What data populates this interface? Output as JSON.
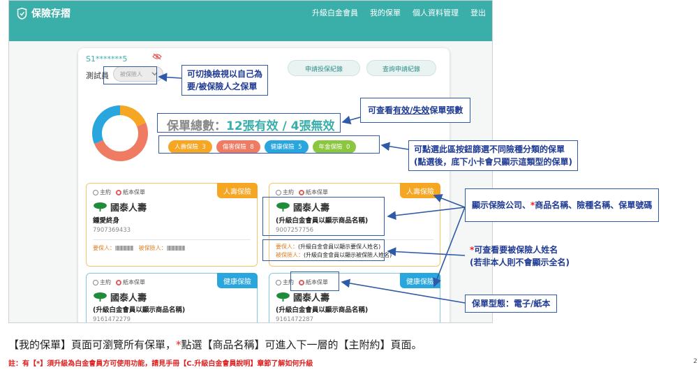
{
  "app": {
    "brand": "保險存摺"
  },
  "nav": [
    {
      "label": "升級白金會員"
    },
    {
      "label": "我的保單"
    },
    {
      "label": "個人資料管理"
    },
    {
      "label": "登出"
    }
  ],
  "account": {
    "masked_id": "S1*******5",
    "name": "測試員",
    "role_select": "被保險人"
  },
  "buttons": {
    "apply_record": "申請投保紀錄",
    "query_record": "查詢申請紀錄"
  },
  "summary": {
    "total_prefix": "保單總數：",
    "active": "12張有效",
    "separator": " / ",
    "inactive": "4張無效",
    "active_count": 12,
    "inactive_count": 4
  },
  "categories": [
    {
      "label": "人壽保險",
      "count": "3",
      "color": "#f5a623"
    },
    {
      "label": "傷害保險",
      "count": "8",
      "color": "#ef7b63"
    },
    {
      "label": "健康保險",
      "count": "5",
      "color": "#29a6de"
    },
    {
      "label": "年金保險",
      "count": "0",
      "color": "#8cc63e"
    }
  ],
  "policy_cards": [
    {
      "type": "人壽保險",
      "main_label": "主約",
      "paper_label": "紙本保單",
      "company": "國泰人壽",
      "product": "鍾愛終身",
      "number": "7907369433",
      "insured_owner_label": "要保人：",
      "insured_person_label": "被保險人：",
      "accent": "#f5a623"
    },
    {
      "type": "人壽保險",
      "main_label": "主約",
      "paper_label": "紙本保單",
      "company": "國泰人壽",
      "product": "(升級白金會員以顯示商品名稱)",
      "number": "9007257756",
      "insured_owner_label": "要保人：",
      "insured_owner_value": "(升級白金會員以顯示要保人姓名)",
      "insured_person_label": "被保險人：",
      "insured_person_value": "(升級白金會員以顯示被保險人姓名)",
      "accent": "#f5a623"
    },
    {
      "type": "健康保險",
      "main_label": "主約",
      "paper_label": "紙本保單",
      "company": "國泰人壽",
      "product": "(升級白金會員以顯示商品名稱)",
      "number": "9161472279",
      "accent": "#29a6de"
    },
    {
      "type": "健康保險",
      "main_label": "主約",
      "paper_label": "紙本保單",
      "company": "國泰人壽",
      "product": "(升級白金會員以顯示商品名稱)",
      "number": "9161472287",
      "accent": "#29a6de"
    }
  ],
  "annotations": {
    "switch_view_1": "可切換檢視以自己為",
    "switch_view_2": "要/被保險人之保單",
    "view_count_pre": "可查看",
    "view_count_u": "有效/失效",
    "view_count_post": "保單張數",
    "filter_1": "可點選此區按鈕篩選不同險種分類的保單",
    "filter_2": "(點選後，底下小卡會只顯示這類型的保單)",
    "display_pre": "顯示保險公司、",
    "display_star": "*",
    "display_post": "商品名稱、險種名稱、保單號碼",
    "name_star": "*",
    "name_1": "可查看要被保險人姓名",
    "name_2": "(若非本人則不會顯示全名)",
    "form_type": "保單型態：電子/紙本"
  },
  "footer": {
    "main_pre": "【我的保單】頁面可瀏覽所有保單，",
    "main_star": "*",
    "main_post": "點選【商品名稱】可進入下一層的【主附約】頁面。",
    "note": "註：有【*】須升級為白金會員方可使用功能，請見手冊【C.升級白金會員說明】章節了解如何升級",
    "page_number": "2"
  },
  "colors": {
    "brand": "#3aafa9",
    "annotation": "#2f5aa8",
    "star": "#e22222"
  }
}
